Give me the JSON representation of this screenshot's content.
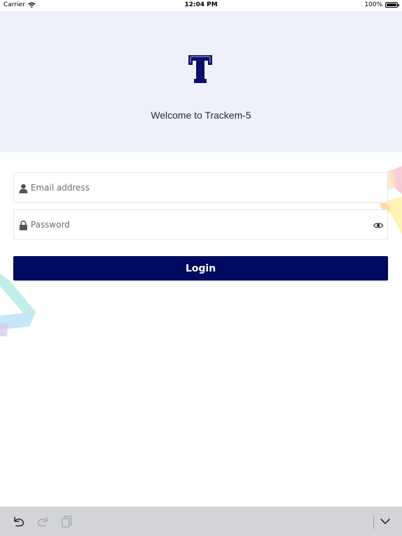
{
  "status_bar": {
    "carrier": "Carrier",
    "time": "12:04 PM",
    "battery": "100%",
    "battery_level": 1.0
  },
  "header": {
    "logo_letter": "T",
    "welcome": "Welcome to Trackem-5",
    "logo_color": "#0a0f6b",
    "background": "#eef0fb"
  },
  "form": {
    "email_placeholder": "Email address",
    "password_placeholder": "Password",
    "login_label": "Login",
    "button_color": "#000a5e"
  },
  "toolbar": {
    "undo_icon": "undo-icon",
    "redo_icon": "redo-icon",
    "copy_icon": "copy-icon",
    "dismiss_icon": "chevron-down-icon"
  }
}
